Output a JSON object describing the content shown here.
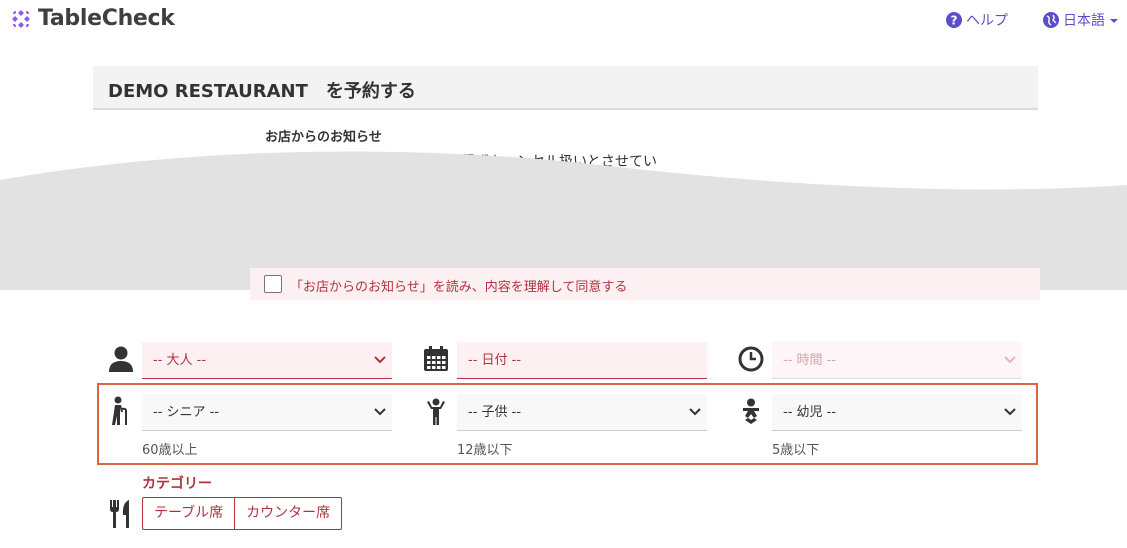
{
  "header": {
    "logo_text": "TableCheck",
    "help_label": "ヘルプ",
    "language_label": "日本語"
  },
  "page": {
    "title": "DEMO RESTAURANT　を予約する"
  },
  "notice": {
    "heading": "お店からのお知らせ",
    "line1": "ご連絡が取れない場合はやむを得ずキャンセル扱いとさせてい",
    "agree_label": "「お店からのお知らせ」を読み、内容を理解して同意する"
  },
  "form": {
    "adults_placeholder": "-- 大人 --",
    "date_placeholder": "-- 日付 --",
    "time_placeholder": "-- 時間 --",
    "seniors_placeholder": "-- シニア --",
    "children_placeholder": "-- 子供 --",
    "infants_placeholder": "-- 幼児 --",
    "seniors_hint": "60歳以上",
    "children_hint": "12歳以下",
    "infants_hint": "5歳以下",
    "category_label": "カテゴリー",
    "categories": [
      "テーブル席",
      "カウンター席"
    ]
  },
  "colors": {
    "brand_purple": "#8b5cf6",
    "accent_red": "#b3323e",
    "highlight_orange": "#d9663e",
    "field_pink": "#fdf0f3"
  }
}
